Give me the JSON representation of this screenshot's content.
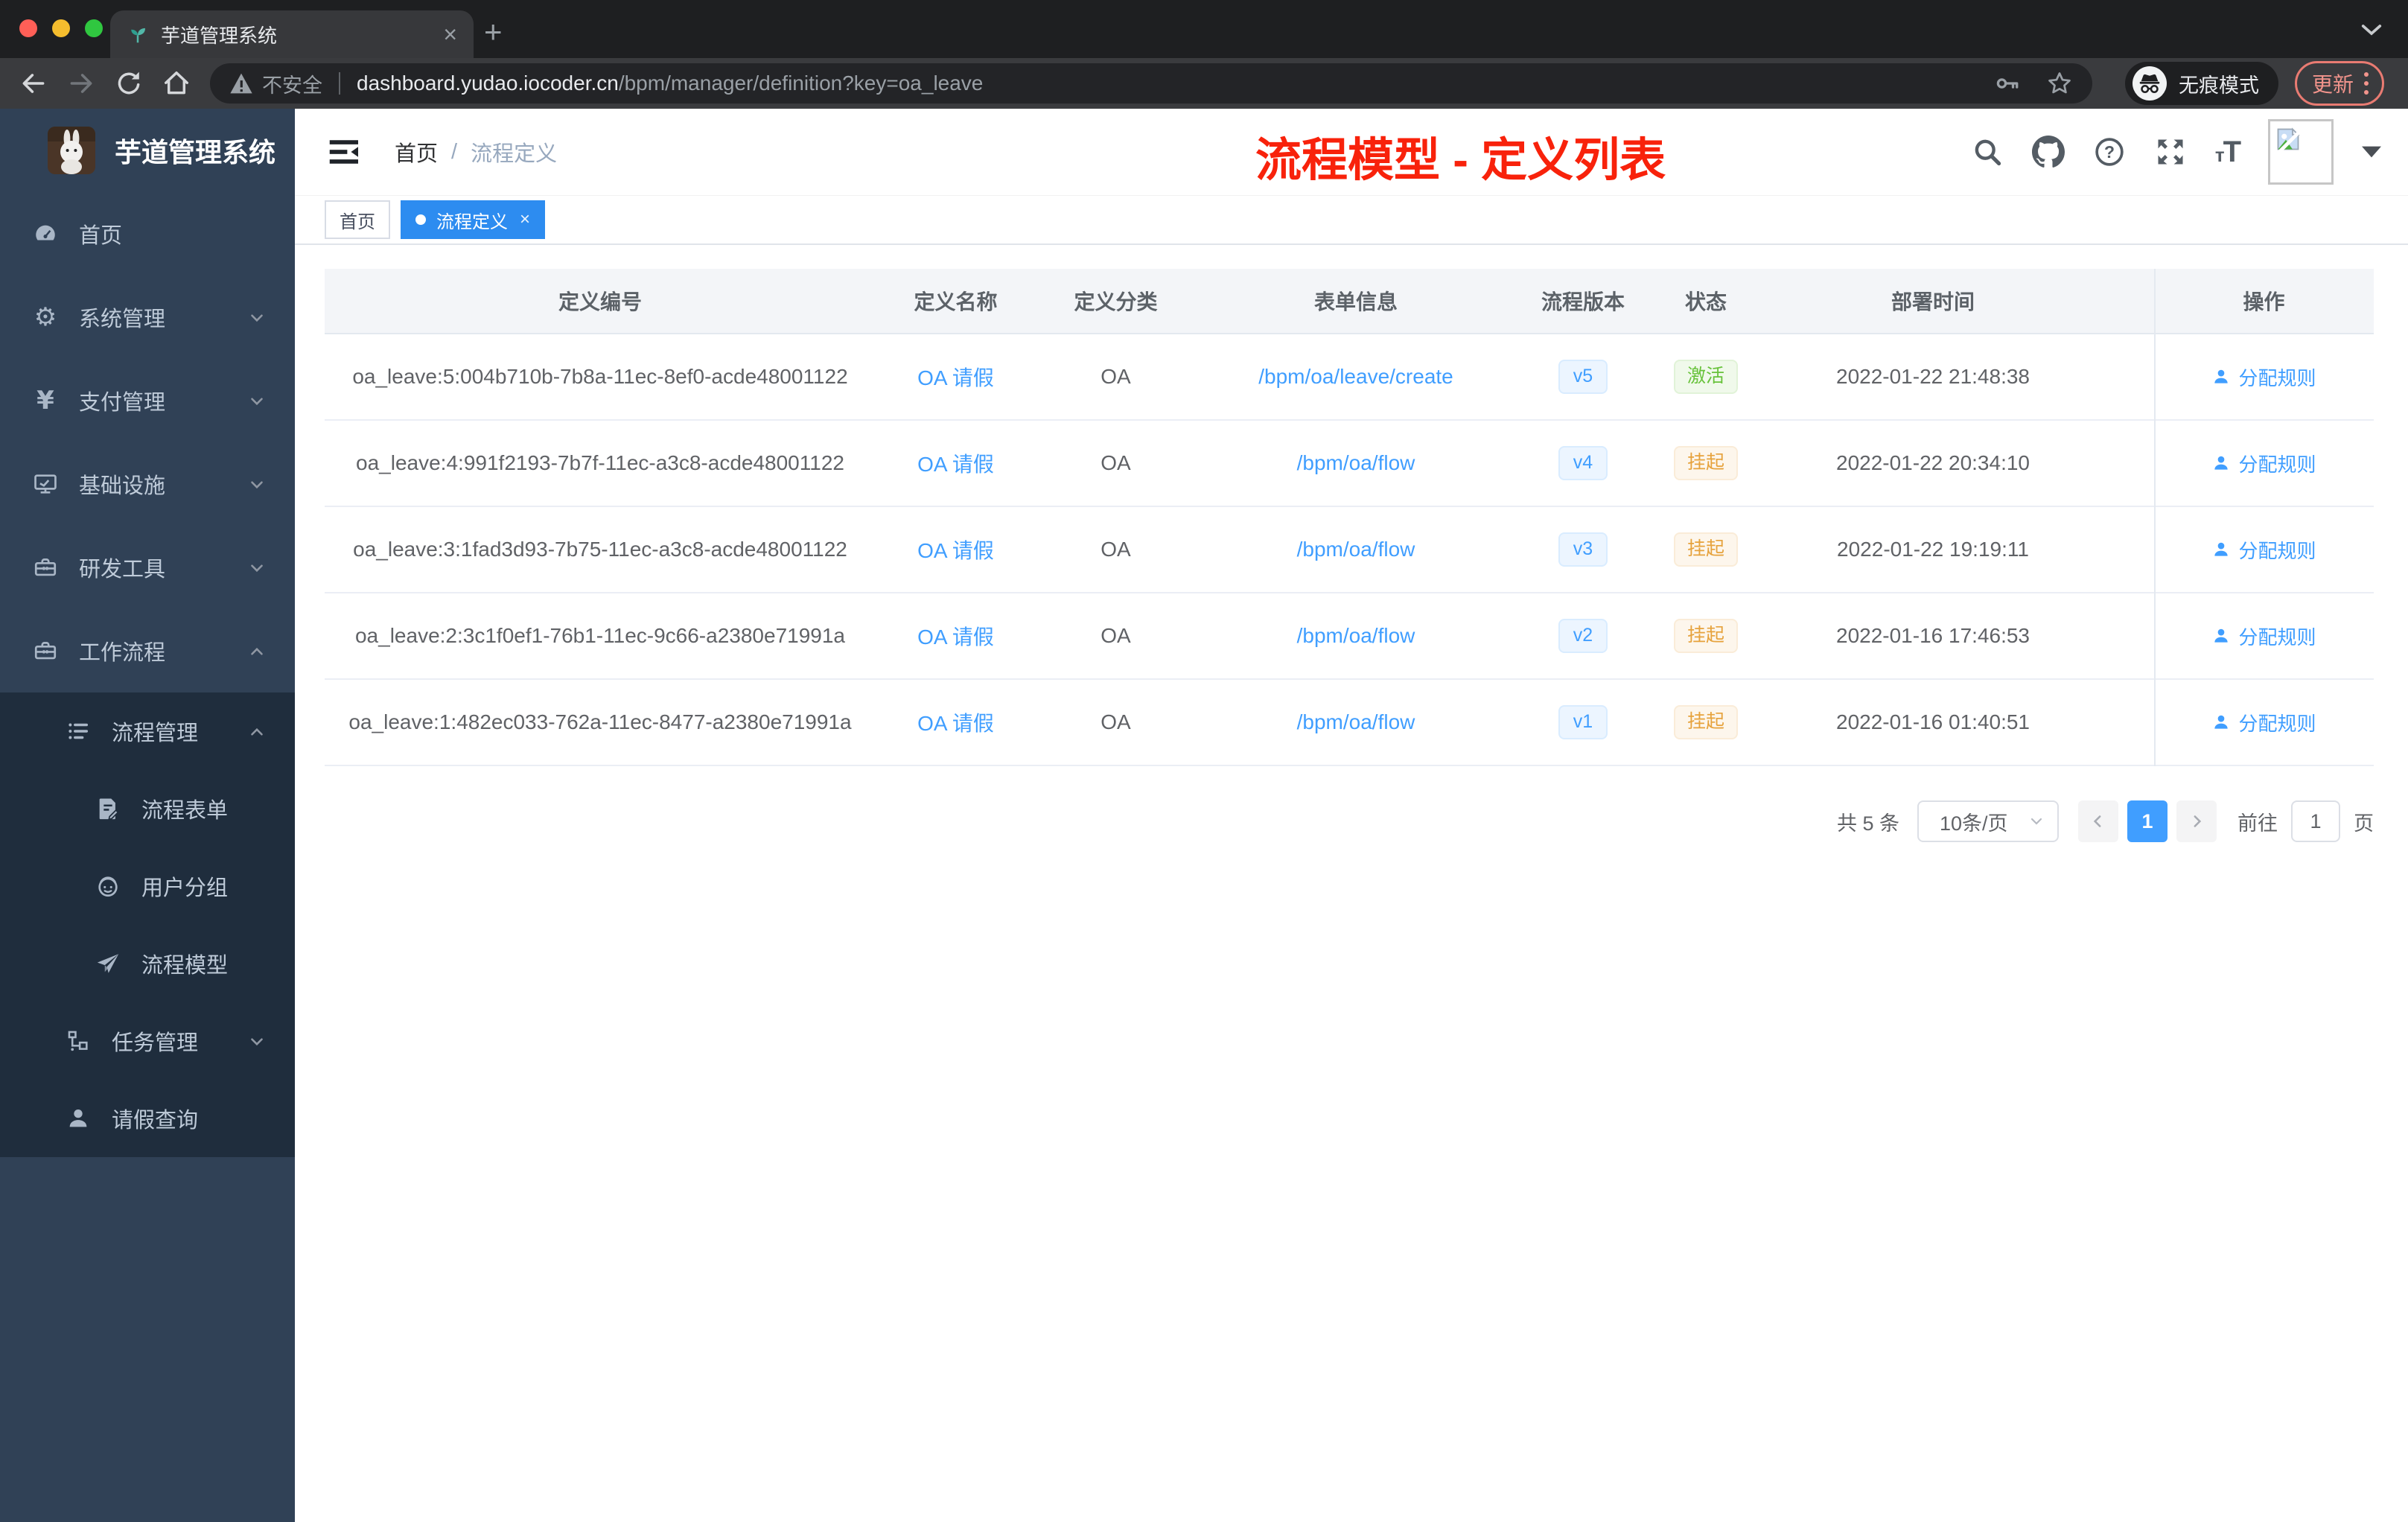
{
  "colors": {
    "accent": "#409eff",
    "success": "#67c23a",
    "warning": "#e6a23c",
    "annotation_red": "#f8220b",
    "sidebar_bg": "#304156",
    "submenu_bg": "#1f2d3d",
    "active_tag_bg": "#2d8cf0"
  },
  "browser": {
    "tab_title": "芋道管理系统",
    "security_label": "不安全",
    "url_host": "dashboard.yudao.iocoder.cn",
    "url_path": "/bpm/manager/definition?key=oa_leave",
    "incognito_label": "无痕模式",
    "update_label": "更新"
  },
  "sidebar": {
    "logo_title": "芋道管理系统",
    "menu": [
      {
        "label": "首页",
        "icon": "dashboard-icon"
      },
      {
        "label": "系统管理",
        "icon": "gear-icon"
      },
      {
        "label": "支付管理",
        "icon": "yen-icon"
      },
      {
        "label": "基础设施",
        "icon": "monitor-icon"
      },
      {
        "label": "研发工具",
        "icon": "toolbox-icon"
      },
      {
        "label": "工作流程",
        "icon": "toolbox-icon"
      },
      {
        "label": "流程管理",
        "icon": "list-icon"
      },
      {
        "label": "流程表单",
        "icon": "form-icon"
      },
      {
        "label": "用户分组",
        "icon": "face-icon"
      },
      {
        "label": "流程模型",
        "icon": "paper-plane-icon"
      },
      {
        "label": "任务管理",
        "icon": "tree-icon"
      },
      {
        "label": "请假查询",
        "icon": "person-icon"
      }
    ]
  },
  "navbar": {
    "breadcrumb_home": "首页",
    "breadcrumb_sep": "/",
    "breadcrumb_current": "流程定义",
    "annotation": "流程模型 - 定义列表",
    "font_size_icon_label": "tT"
  },
  "tags": {
    "home": "首页",
    "current": "流程定义",
    "close": "×"
  },
  "table": {
    "headers": {
      "id": "定义编号",
      "name": "定义名称",
      "category": "定义分类",
      "form": "表单信息",
      "version": "流程版本",
      "status": "状态",
      "deploy_time": "部署时间",
      "action": "操作"
    },
    "rows": [
      {
        "id": "oa_leave:5:004b710b-7b8a-11ec-8ef0-acde48001122",
        "name": "OA 请假",
        "category": "OA",
        "form": "/bpm/oa/leave/create",
        "version": "v5",
        "status": "激活",
        "deploy_time": "2022-01-22 21:48:38",
        "action": "分配规则"
      },
      {
        "id": "oa_leave:4:991f2193-7b7f-11ec-a3c8-acde48001122",
        "name": "OA 请假",
        "category": "OA",
        "form": "/bpm/oa/flow",
        "version": "v4",
        "status": "挂起",
        "deploy_time": "2022-01-22 20:34:10",
        "action": "分配规则"
      },
      {
        "id": "oa_leave:3:1fad3d93-7b75-11ec-a3c8-acde48001122",
        "name": "OA 请假",
        "category": "OA",
        "form": "/bpm/oa/flow",
        "version": "v3",
        "status": "挂起",
        "deploy_time": "2022-01-22 19:19:11",
        "action": "分配规则"
      },
      {
        "id": "oa_leave:2:3c1f0ef1-76b1-11ec-9c66-a2380e71991a",
        "name": "OA 请假",
        "category": "OA",
        "form": "/bpm/oa/flow",
        "version": "v2",
        "status": "挂起",
        "deploy_time": "2022-01-16 17:46:53",
        "action": "分配规则"
      },
      {
        "id": "oa_leave:1:482ec033-762a-11ec-8477-a2380e71991a",
        "name": "OA 请假",
        "category": "OA",
        "form": "/bpm/oa/flow",
        "version": "v1",
        "status": "挂起",
        "deploy_time": "2022-01-16 01:40:51",
        "action": "分配规则"
      }
    ]
  },
  "pagination": {
    "total_label": "共 5 条",
    "page_size": "10条/页",
    "current_page": "1",
    "goto_label": "前往",
    "goto_value": "1",
    "unit_label": "页"
  }
}
